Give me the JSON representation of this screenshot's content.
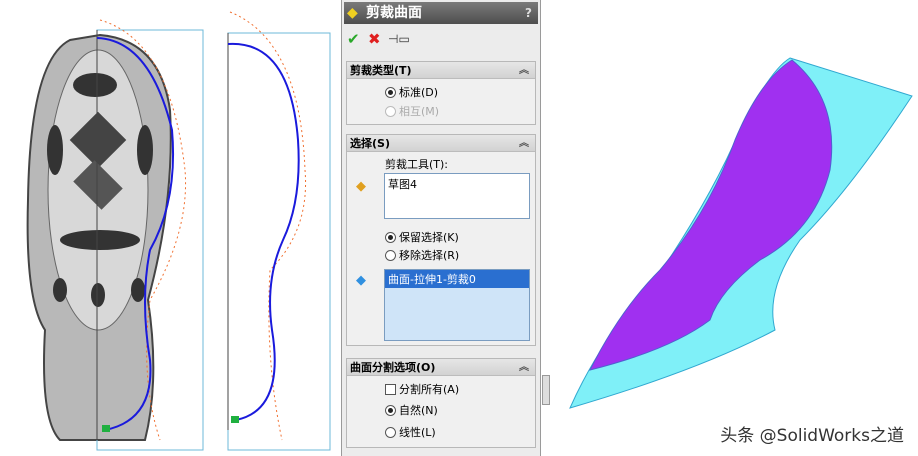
{
  "panel": {
    "title": "剪裁曲面",
    "help": "?",
    "toolbar": {
      "ok": "✔",
      "cancel": "✖",
      "pin": "pin"
    },
    "trim_type": {
      "header": "剪裁类型(T)",
      "options": [
        {
          "label": "标准(D)",
          "selected": true,
          "enabled": true
        },
        {
          "label": "相互(M)",
          "selected": false,
          "enabled": false
        }
      ]
    },
    "selection": {
      "header": "选择(S)",
      "tool_label": "剪裁工具(T):",
      "tool_items": [
        "草图4"
      ],
      "options": [
        {
          "label": "保留选择(K)",
          "selected": true
        },
        {
          "label": "移除选择(R)",
          "selected": false
        }
      ],
      "piece_items": [
        "曲面-拉伸1-剪裁0"
      ]
    },
    "split": {
      "header": "曲面分割选项(O)",
      "split_all": {
        "label": "分割所有(A)",
        "checked": false
      },
      "options": [
        {
          "label": "自然(N)",
          "selected": true
        },
        {
          "label": "线性(L)",
          "selected": false
        }
      ]
    }
  },
  "colors": {
    "sketch": "#1a1adc",
    "hatch": "#f07030",
    "surface": "#7ff0f8",
    "trimmed": "#a030f0"
  },
  "watermark": "头条 @SolidWorks之道"
}
